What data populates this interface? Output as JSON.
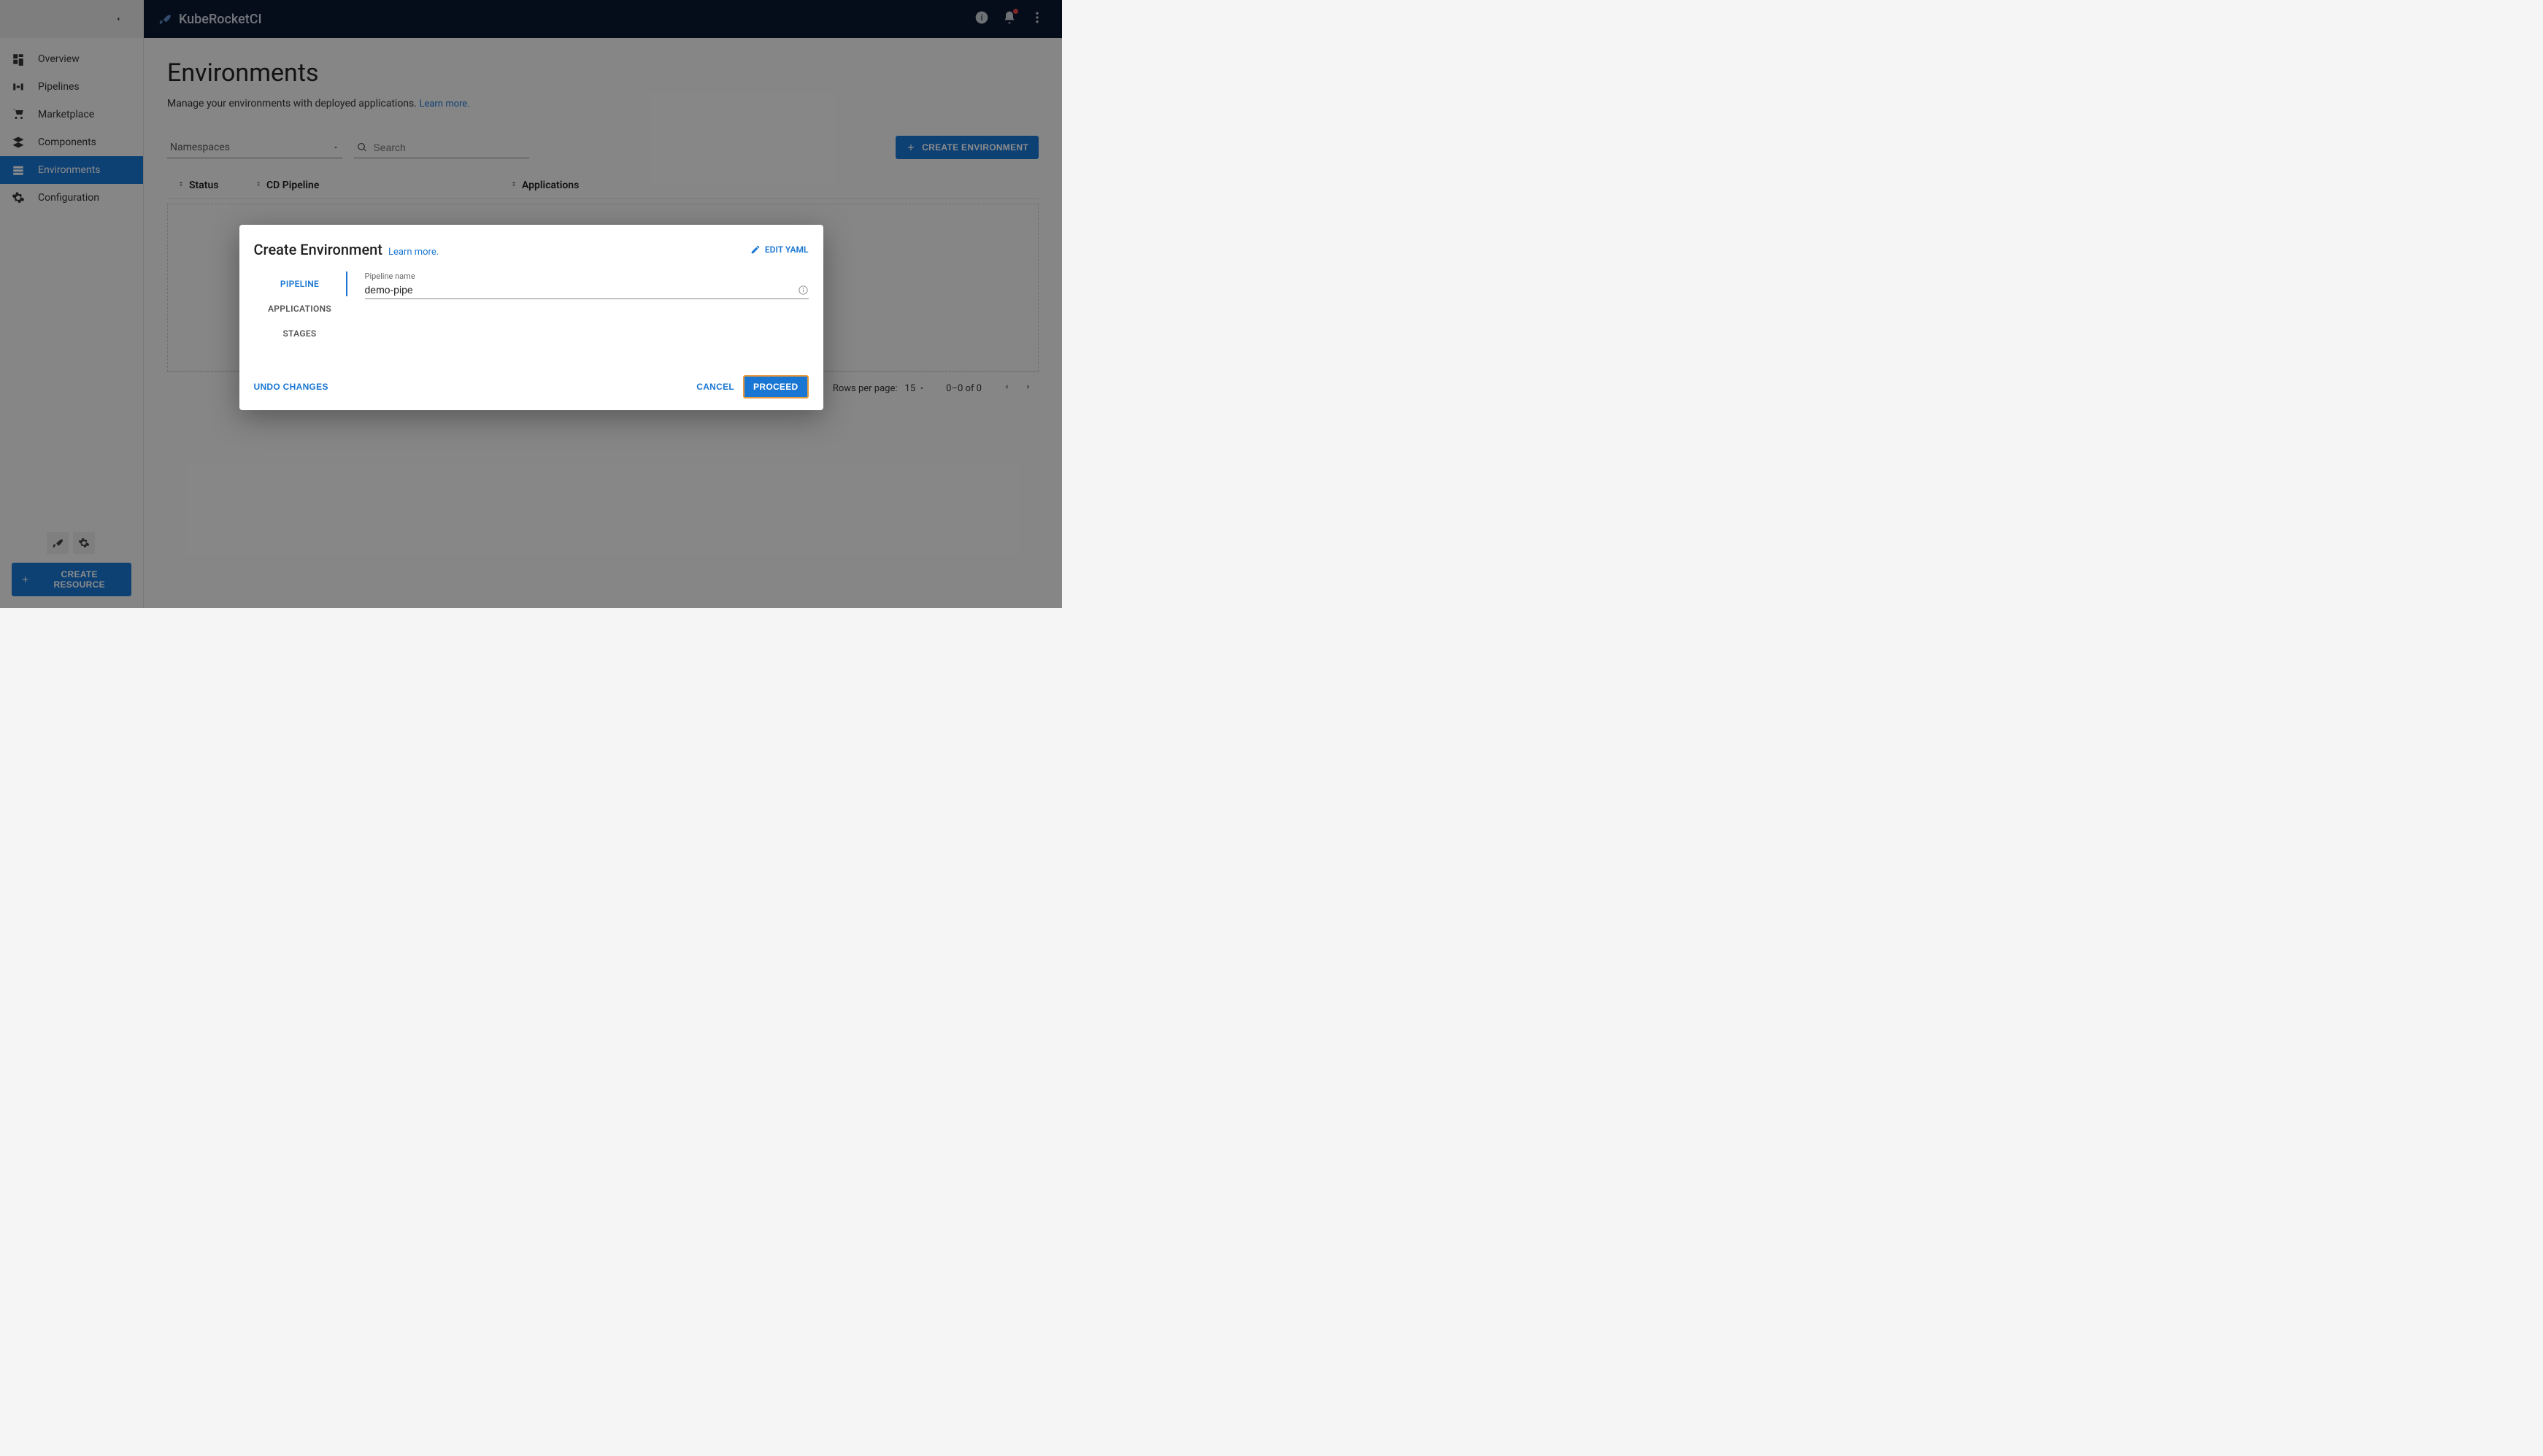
{
  "brand": "KubeRocketCI",
  "sidebar": {
    "items": [
      {
        "label": "Overview"
      },
      {
        "label": "Pipelines"
      },
      {
        "label": "Marketplace"
      },
      {
        "label": "Components"
      },
      {
        "label": "Environments"
      },
      {
        "label": "Configuration"
      }
    ],
    "create_resource": "CREATE RESOURCE"
  },
  "page": {
    "title": "Environments",
    "subtitle": "Manage your environments with deployed applications.",
    "learn_more": "Learn more."
  },
  "filters": {
    "namespaces_label": "Namespaces",
    "search_placeholder": "Search",
    "create_env": "CREATE ENVIRONMENT"
  },
  "table": {
    "columns": {
      "status": "Status",
      "pipeline": "CD Pipeline",
      "apps": "Applications"
    },
    "rows_per_page_label": "Rows per page:",
    "rows_per_page_value": "15",
    "range": "0–0 of 0"
  },
  "dialog": {
    "title": "Create Environment",
    "learn_more": "Learn more.",
    "edit_yaml": "EDIT YAML",
    "tabs": {
      "pipeline": "PIPELINE",
      "applications": "APPLICATIONS",
      "stages": "STAGES"
    },
    "field_label": "Pipeline name",
    "field_value": "demo-pipe",
    "undo": "UNDO CHANGES",
    "cancel": "CANCEL",
    "proceed": "PROCEED"
  }
}
